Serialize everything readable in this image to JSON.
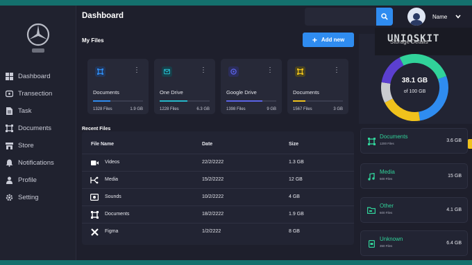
{
  "header": {
    "title": "Dashboard",
    "user_name": "Name"
  },
  "sidebar": {
    "items": [
      {
        "label": "Dashboard",
        "icon": "grid-icon"
      },
      {
        "label": "Transection",
        "icon": "wallet-icon"
      },
      {
        "label": "Task",
        "icon": "clipboard-icon"
      },
      {
        "label": "Documents",
        "icon": "document-icon"
      },
      {
        "label": "Store",
        "icon": "store-icon"
      },
      {
        "label": "Notifications",
        "icon": "bell-icon"
      },
      {
        "label": "Profile",
        "icon": "user-icon"
      },
      {
        "label": "Setting",
        "icon": "gear-icon"
      }
    ]
  },
  "my_files": {
    "title": "My Files",
    "add_label": "Add new",
    "cards": [
      {
        "name": "Documents",
        "files": "1328 Files",
        "size": "1.9 GB",
        "color": "#2f8cf0",
        "progress": 0.35
      },
      {
        "name": "One Drive",
        "files": "1228 Files",
        "size": "6.3 GB",
        "color": "#26b7c9",
        "progress": 0.55
      },
      {
        "name": "Google Drive",
        "files": "1398 Files",
        "size": "9 GB",
        "color": "#5b63e6",
        "progress": 0.72
      },
      {
        "name": "Documents",
        "files": "1567 Files",
        "size": "3 GB",
        "color": "#f0c21c",
        "progress": 0.25
      }
    ]
  },
  "recent_files": {
    "title": "Recent Files",
    "columns": [
      "File Name",
      "Date",
      "Size"
    ],
    "rows": [
      {
        "name": "Videos",
        "date": "22/2/2222",
        "size": "1.3 GB",
        "icon": "video-icon"
      },
      {
        "name": "Media",
        "date": "15/2/2222",
        "size": "12 GB",
        "icon": "media-icon"
      },
      {
        "name": "Sounds",
        "date": "10/2/2222",
        "size": "4 GB",
        "icon": "sound-icon"
      },
      {
        "name": "Documents",
        "date": "18/2/2222",
        "size": "1.9 GB",
        "icon": "document-icon"
      },
      {
        "name": "Figma",
        "date": "1/2/2222",
        "size": "8 GB",
        "icon": "figma-icon"
      }
    ]
  },
  "storage": {
    "used": "38.1 GB",
    "total": "of 100 GB",
    "segments": [
      {
        "color": "#2f8cf0",
        "value": 28
      },
      {
        "color": "#f0c21c",
        "value": 20
      },
      {
        "color": "#c9cbd0",
        "value": 10
      },
      {
        "color": "#5b3fd0",
        "value": 15
      },
      {
        "color": "#31d39a",
        "value": 27
      }
    ],
    "items": [
      {
        "name": "Documents",
        "files": "1200 Files",
        "size": "3.6 GB",
        "icon": "document-icon"
      },
      {
        "name": "Media",
        "files": "500 Files",
        "size": "15 GB",
        "icon": "music-icon"
      },
      {
        "name": "Other",
        "files": "600 Files",
        "size": "4.1 GB",
        "icon": "folder-icon"
      },
      {
        "name": "Unknown",
        "files": "350 Files",
        "size": "6.4 GB",
        "icon": "file-icon"
      }
    ]
  },
  "overlay": {
    "brand": "UNIQSKIT",
    "text": "Storage Details"
  },
  "theme": {
    "accent": "#2f8cf0",
    "green": "#31d39a",
    "bg": "#1e1f2c"
  }
}
